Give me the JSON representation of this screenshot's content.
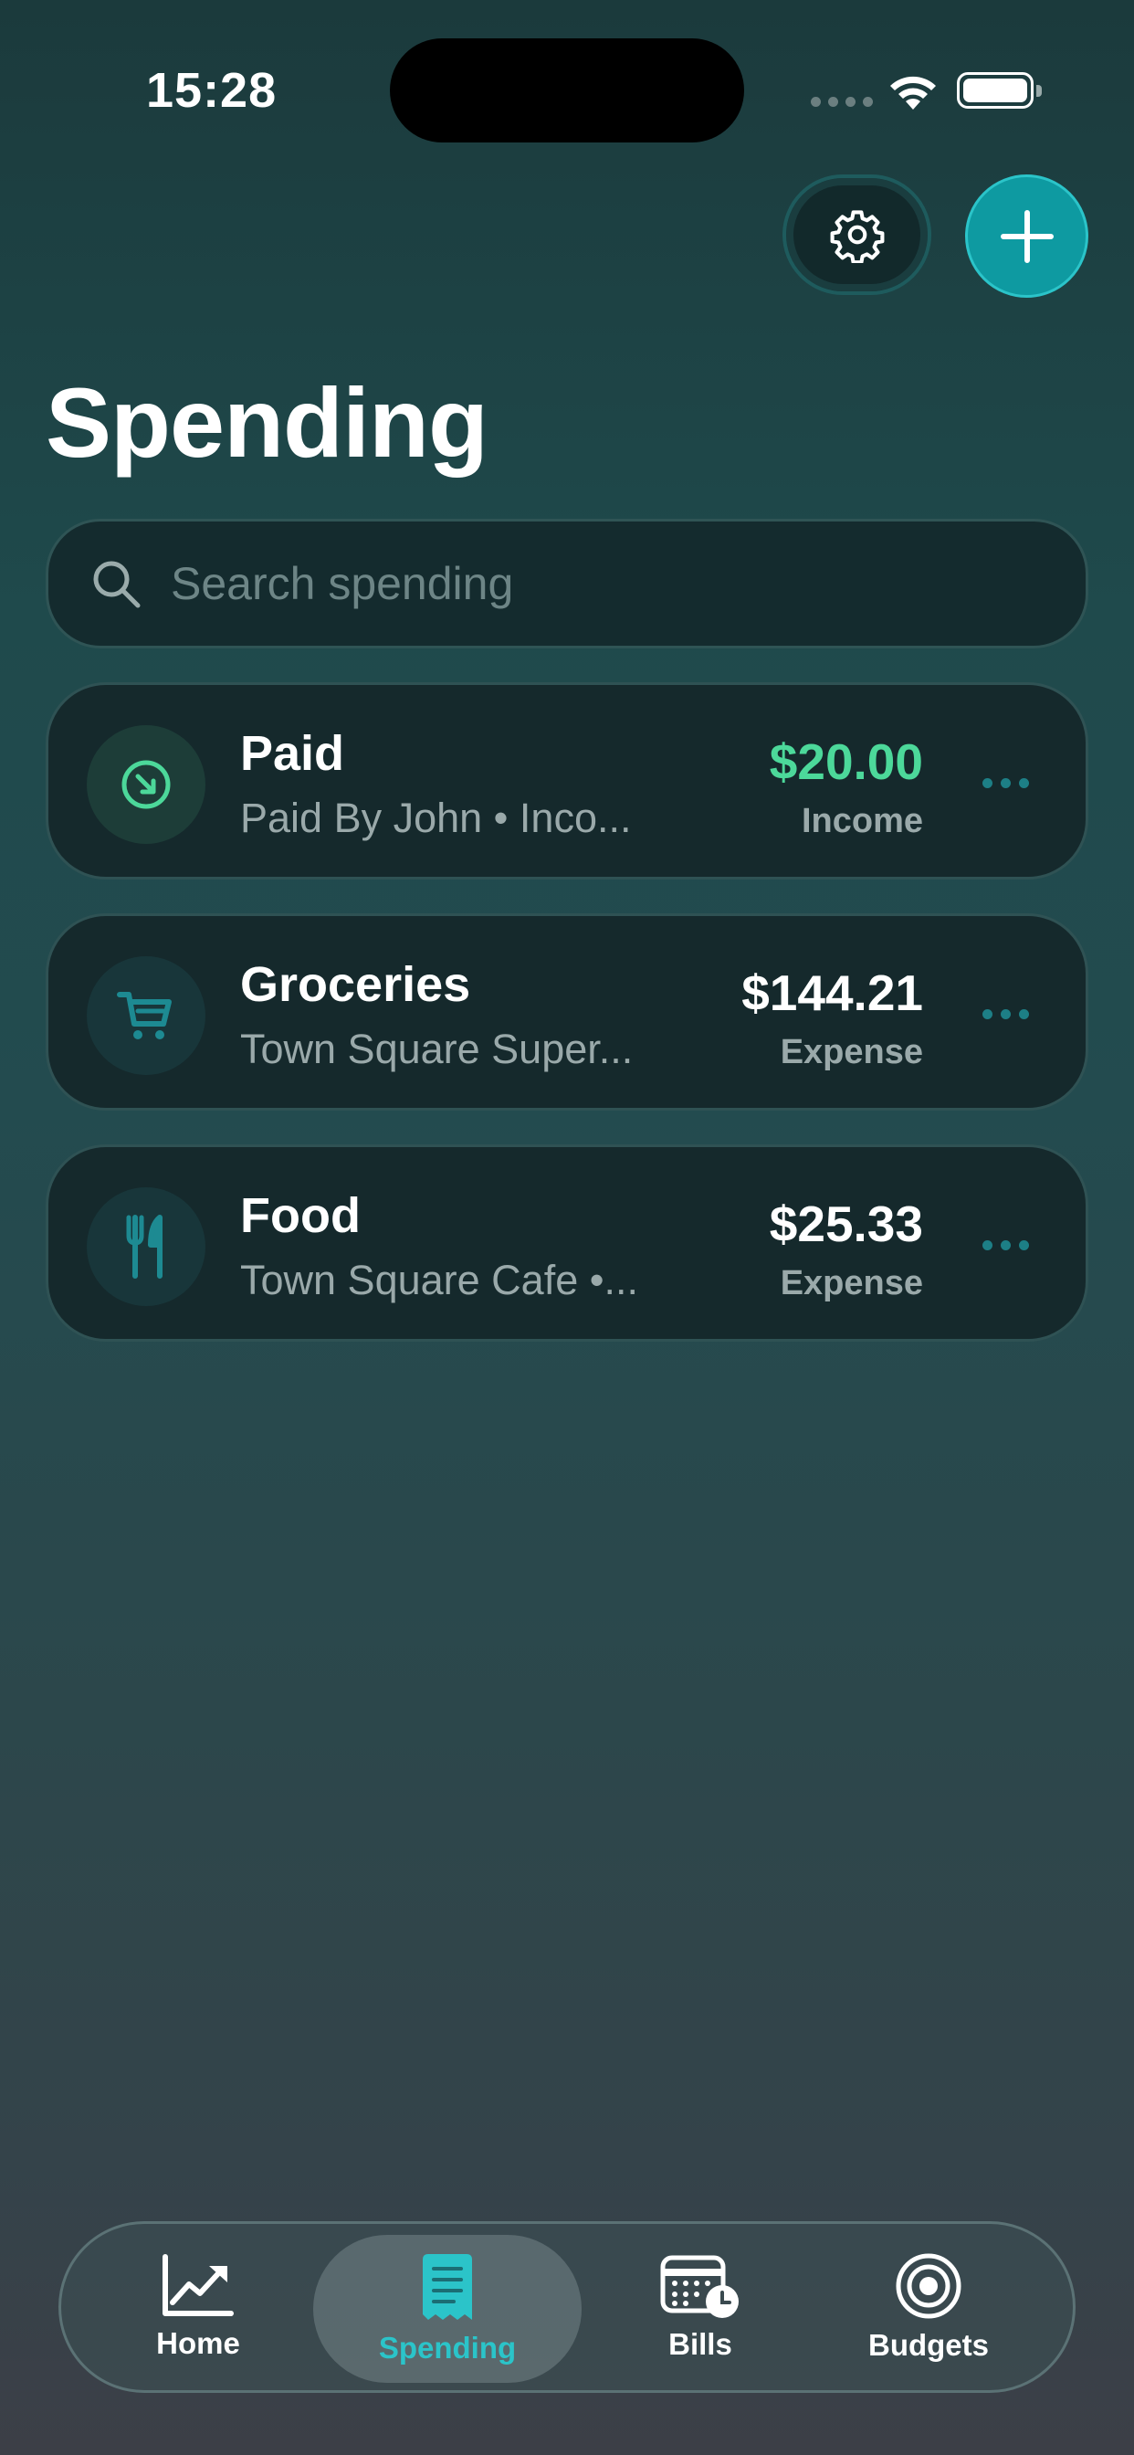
{
  "status_bar": {
    "time": "15:28"
  },
  "header": {
    "title": "Spending"
  },
  "search": {
    "placeholder": "Search spending"
  },
  "transactions": [
    {
      "title": "Paid",
      "subtitle": "Paid By John • Inco...",
      "amount": "$20.00",
      "type": "Income",
      "icon": "arrow-down-right-circle-icon",
      "amount_color": "#4cd89a"
    },
    {
      "title": "Groceries",
      "subtitle": "Town Square Super...",
      "amount": "$144.21",
      "type": "Expense",
      "icon": "cart-icon",
      "amount_color": "#ffffff"
    },
    {
      "title": "Food",
      "subtitle": "Town Square Cafe •...",
      "amount": "$25.33",
      "type": "Expense",
      "icon": "fork-knife-icon",
      "amount_color": "#ffffff"
    }
  ],
  "tab_bar": {
    "tabs": [
      {
        "label": "Home",
        "icon": "chart-line-icon"
      },
      {
        "label": "Spending",
        "icon": "receipt-icon",
        "active": true
      },
      {
        "label": "Bills",
        "icon": "calendar-clock-icon"
      },
      {
        "label": "Budgets",
        "icon": "target-icon"
      }
    ]
  },
  "colors": {
    "accent": "#2bc4c9",
    "income": "#4cd89a",
    "icon_teal": "#1d8a92"
  }
}
